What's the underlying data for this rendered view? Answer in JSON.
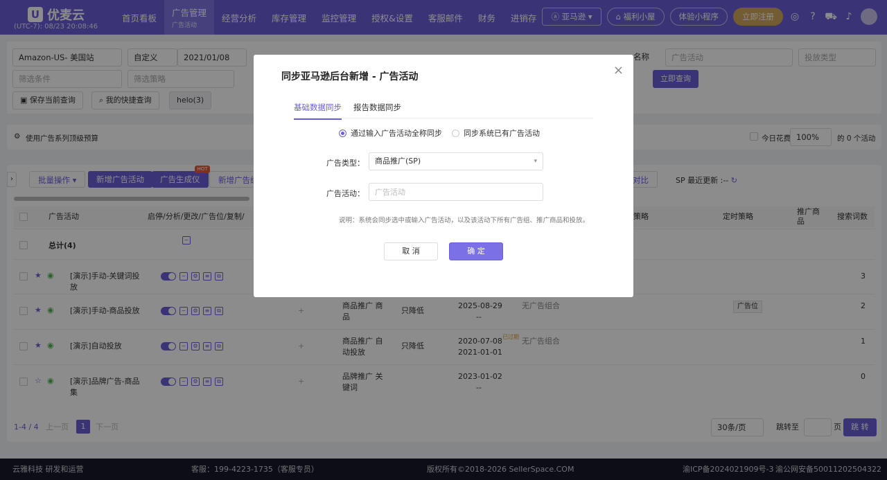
{
  "header": {
    "logo_text": "优麦云",
    "timezone": "(UTC-7): 08/23 20:08:46",
    "nav": [
      {
        "label": "首页看板"
      },
      {
        "label": "广告管理",
        "sub": "广告活动"
      },
      {
        "label": "经营分析"
      },
      {
        "label": "库存管理"
      },
      {
        "label": "监控管理"
      },
      {
        "label": "授权&设置"
      },
      {
        "label": "客服邮件"
      },
      {
        "label": "财务"
      },
      {
        "label": "进销存"
      }
    ],
    "amazon_label": "亚马逊",
    "welfare": "福利小屋",
    "miniapp": "体验小程序",
    "register": "立即注册"
  },
  "filters": {
    "marketplace": "Amazon-US- 美国站",
    "date_mode": "自定义",
    "date_start": "2021/01/08",
    "filter_cond_placeholder": "筛选条件",
    "filter_strategy_placeholder": "筛选策略",
    "name_label": "名称",
    "campaign_placeholder": "广告活动",
    "targeting_type_placeholder": "投放类型",
    "query_button": "立即查询",
    "save_query": "保存当前查询",
    "my_queries": "我的快捷查询",
    "saved_query": "helo(3)"
  },
  "info": {
    "use_budget": "使用广告系列顶级预算",
    "today_spend": "今日花费",
    "percent": "100%",
    "count_text": "的 0 个活动"
  },
  "toolbar": {
    "batch": "批量操作",
    "new_campaign": "新增广告活动",
    "generator": "广告生成仪",
    "hot": "HOT",
    "new_group": "新增广告组",
    "compare": "对比",
    "sp_update": "SP 最近更新 :--"
  },
  "table": {
    "headers": {
      "campaign": "广告活动",
      "actions": "启停/分析/更改/广告位/复制/",
      "strategy": "策略",
      "timing": "定时策略",
      "products": "推广商品",
      "search_terms": "搜索词数"
    },
    "total": "总计(4)",
    "rows": [
      {
        "name": "[演示]手动-关键词投放",
        "type": "",
        "bid": "",
        "date1": "",
        "date2": "",
        "combo": "",
        "tag": "",
        "last": "3"
      },
      {
        "name": "[演示]手动-商品投放",
        "type": "商品推广 商品",
        "bid": "只降低",
        "date1": "2025-08-29",
        "date2": "--",
        "combo": "无广告组合",
        "tag": "广告位",
        "last": "2"
      },
      {
        "name": "[演示]自动投放",
        "type": "商品推广 自动投放",
        "bid": "只降低",
        "date1": "2020-07-08",
        "date2": "2021-01-01",
        "combo": "无广告组合",
        "tag": "",
        "last": "1",
        "expired": "已过期"
      },
      {
        "name": "[演示]品牌广告-商品集",
        "type": "品牌推广 关键词",
        "bid": "",
        "date1": "2023-01-02",
        "date2": "--",
        "combo": "",
        "tag": "",
        "last": "0"
      }
    ]
  },
  "pager": {
    "range": "1-4 / 4",
    "prev": "上一页",
    "page": "1",
    "next": "下一页",
    "per_page": "30条/页",
    "jump_to": "跳转至",
    "page_unit": "页",
    "jump": "跳 转"
  },
  "footer": {
    "company": "云雅科技 研发和运营",
    "service": "客服：199-4223-1735（客服专员）",
    "copyright": "版权所有©2018-2026 SellerSpace.COM",
    "icp": "渝ICP备2024021909号-3",
    "police": "渝公网安备50011202504322号"
  },
  "modal": {
    "title": "同步亚马逊后台新增 - 广告活动",
    "tabs": [
      "基础数据同步",
      "报告数据同步"
    ],
    "radio_1": "通过输入广告活动全称同步",
    "radio_2": "同步系统已有广告活动",
    "type_label": "广告类型：",
    "type_value": "商品推广(SP)",
    "campaign_label": "广告活动：",
    "campaign_placeholder": "广告活动",
    "note": "说明：系统会同步选中或输入广告活动，以及该活动下所有广告组、推广商品和投放。",
    "cancel": "取 消",
    "confirm": "确 定"
  }
}
